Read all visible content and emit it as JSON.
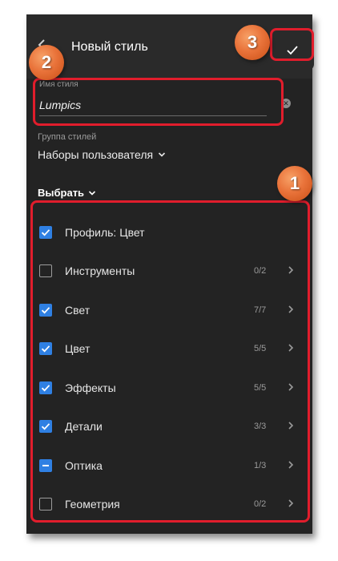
{
  "header": {
    "title": "Новый стиль"
  },
  "form": {
    "name_label": "Имя стиля",
    "name_value": "Lumpics",
    "group_label": "Группа стилей",
    "group_value": "Наборы пользователя"
  },
  "choose": {
    "label": "Выбрать"
  },
  "settings": [
    {
      "label": "Профиль: Цвет",
      "state": "checked",
      "count": ""
    },
    {
      "label": "Инструменты",
      "state": "unchecked",
      "count": "0/2"
    },
    {
      "label": "Свет",
      "state": "checked",
      "count": "7/7"
    },
    {
      "label": "Цвет",
      "state": "checked",
      "count": "5/5"
    },
    {
      "label": "Эффекты",
      "state": "checked",
      "count": "5/5"
    },
    {
      "label": "Детали",
      "state": "checked",
      "count": "3/3"
    },
    {
      "label": "Оптика",
      "state": "indeterminate",
      "count": "1/3"
    },
    {
      "label": "Геометрия",
      "state": "unchecked",
      "count": "0/2"
    }
  ],
  "annotations": {
    "badge1": "1",
    "badge2": "2",
    "badge3": "3"
  },
  "colors": {
    "accent": "#2f80e3",
    "annotation": "#e11d2c",
    "badge": "#e9733a",
    "panel": "#232323"
  }
}
